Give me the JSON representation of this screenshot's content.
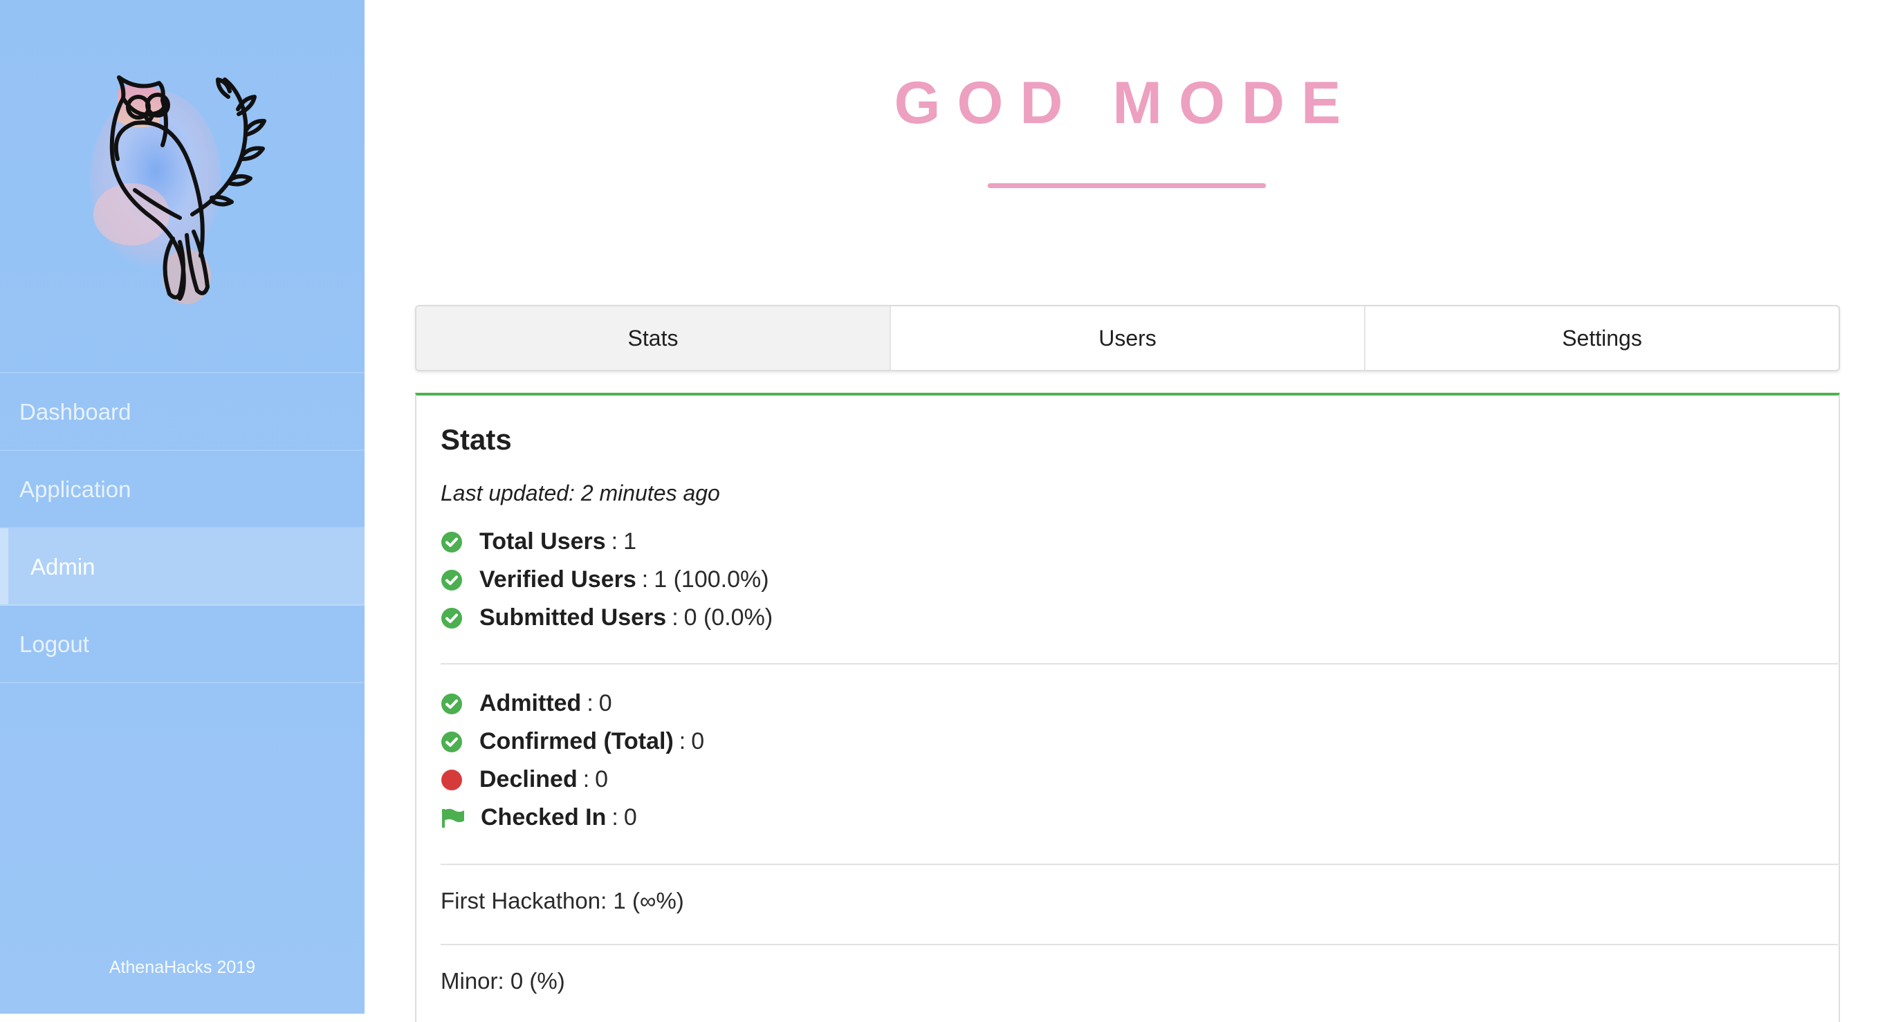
{
  "sidebar": {
    "logo_icon": "owl-logo-icon",
    "items": [
      {
        "label": "Dashboard",
        "active": false
      },
      {
        "label": "Application",
        "active": false
      },
      {
        "label": "Admin",
        "active": true
      },
      {
        "label": "Logout",
        "active": false
      }
    ],
    "footer": "AthenaHacks 2019",
    "background_color": "#95c2f5"
  },
  "header": {
    "title": "GOD MODE",
    "accent_color": "#eda0c0"
  },
  "tabs": [
    {
      "label": "Stats",
      "active": true
    },
    {
      "label": "Users",
      "active": false
    },
    {
      "label": "Settings",
      "active": false
    }
  ],
  "stats": {
    "heading": "Stats",
    "last_updated": "Last updated: 2 minutes ago",
    "group1": [
      {
        "icon": "check-circle-icon",
        "label": "Total Users",
        "value": "1"
      },
      {
        "icon": "check-circle-icon",
        "label": "Verified Users",
        "value": "1 (100.0%)"
      },
      {
        "icon": "check-circle-icon",
        "label": "Submitted Users",
        "value": "0 (0.0%)"
      }
    ],
    "group2": [
      {
        "icon": "check-circle-icon",
        "label": "Admitted",
        "value": "0"
      },
      {
        "icon": "check-circle-icon",
        "label": "Confirmed (Total)",
        "value": "0"
      },
      {
        "icon": "red-circle-icon",
        "label": "Declined",
        "value": "0"
      },
      {
        "icon": "flag-icon",
        "label": "Checked In",
        "value": "0"
      }
    ],
    "first_hackathon": "First Hackathon: 1 (∞%)",
    "minor": "Minor: 0 (%)",
    "colors": {
      "success": "#4caf50",
      "danger": "#d63b3b",
      "panel_border": "#4db24f"
    }
  }
}
